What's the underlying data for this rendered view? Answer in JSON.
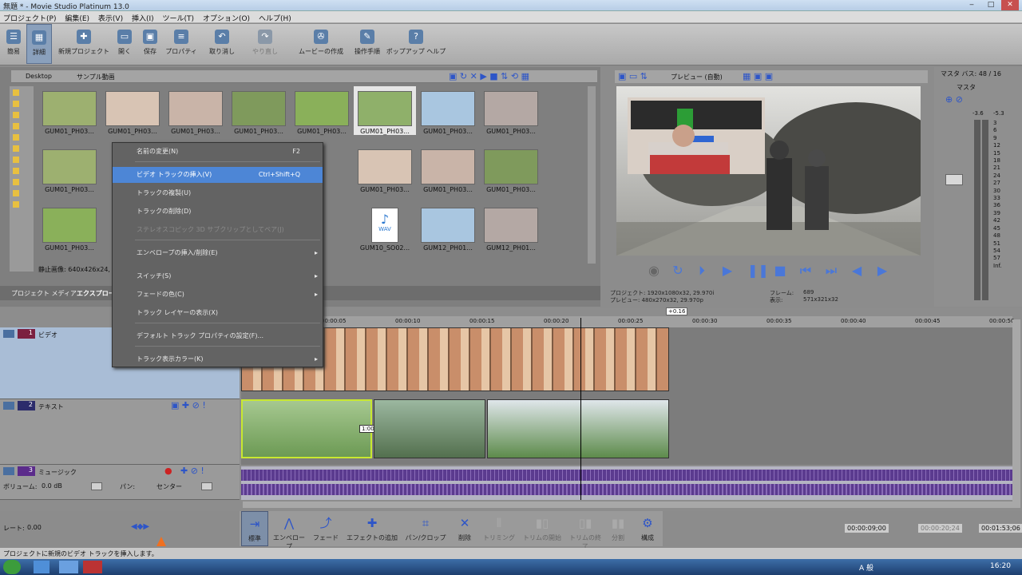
{
  "window": {
    "title": "無題 * - Movie Studio Platinum 13.0",
    "controls": [
      "‒",
      "□",
      "✕"
    ]
  },
  "menu": [
    "プロジェクト(P)",
    "編集(E)",
    "表示(V)",
    "挿入(I)",
    "ツール(T)",
    "オプション(O)",
    "ヘルプ(H)"
  ],
  "toolbar": [
    {
      "label": "簡易",
      "icon": "simple-view-icon",
      "disabled": false
    },
    {
      "label": "詳細",
      "icon": "detail-view-icon",
      "disabled": false
    },
    {
      "label": "新規プロジェクト",
      "icon": "new-project-icon",
      "disabled": false
    },
    {
      "label": "開く",
      "icon": "open-folder-icon",
      "disabled": false
    },
    {
      "label": "保存",
      "icon": "save-icon",
      "disabled": false
    },
    {
      "label": "プロパティ",
      "icon": "properties-icon",
      "disabled": false
    },
    {
      "label": "取り消し",
      "icon": "undo-icon",
      "disabled": false
    },
    {
      "label": "やり直し",
      "icon": "redo-icon",
      "disabled": true
    },
    {
      "label": "ムービーの作成",
      "icon": "make-movie-icon",
      "disabled": false
    },
    {
      "label": "操作手順",
      "icon": "wizard-icon",
      "disabled": false
    },
    {
      "label": "ポップアップ ヘルプ",
      "icon": "popup-help-icon",
      "disabled": false
    }
  ],
  "explorer": {
    "path": [
      "Desktop",
      "サンプル動画"
    ],
    "status": "静止画像: 640x426x24,",
    "thumbs": [
      "GUM01_PH03...",
      "GUM01_PH03...",
      "GUM01_PH03...",
      "GUM01_PH03...",
      "GUM01_PH03...",
      "GUM01_PH03...",
      "GUM01_PH03...",
      "GUM01_PH03...",
      "GUM01_PH03...",
      "GUM01_PH03...",
      "GUM01_PH03...",
      "GUM01_PH03...",
      "GUM01_PH03...",
      "GUM01_PH03...",
      "GUM01_PH03...",
      "GUM01_PH03...",
      "GUM01_PH03...",
      "GUM01_PH03...",
      "GUM01_PH03...",
      "GUM01_PH03...",
      "GUM01_PH03...",
      "GUM01_PH03...",
      "GUM10_SO02...",
      "GUM10_SO02...",
      "GUM12_PH01...",
      "GUM12_PH01..."
    ],
    "tabs": [
      "プロジェクト メディア",
      "エクスプロー"
    ],
    "wav_label": "WAV"
  },
  "context_menu": [
    {
      "label": "名前の変更(N)",
      "shortcut": "F2",
      "submenu": false,
      "selected": false,
      "disabled": false
    },
    {
      "label": "ビデオ トラックの挿入(V)",
      "shortcut": "Ctrl+Shift+Q",
      "submenu": false,
      "selected": true,
      "disabled": false
    },
    {
      "label": "トラックの複製(U)",
      "shortcut": "",
      "submenu": false,
      "selected": false,
      "disabled": false
    },
    {
      "label": "トラックの削除(D)",
      "shortcut": "",
      "submenu": false,
      "selected": false,
      "disabled": false
    },
    {
      "label": "ステレオスコピック 3D サブクリップとしてペア(J)",
      "shortcut": "",
      "submenu": false,
      "selected": false,
      "disabled": true
    },
    {
      "label": "エンベロープの挿入/削除(E)",
      "shortcut": "",
      "submenu": true,
      "selected": false,
      "disabled": false
    },
    {
      "label": "スイッチ(S)",
      "shortcut": "",
      "submenu": true,
      "selected": false,
      "disabled": false
    },
    {
      "label": "フェードの色(C)",
      "shortcut": "",
      "submenu": true,
      "selected": false,
      "disabled": false
    },
    {
      "label": "トラック レイヤーの表示(X)",
      "shortcut": "",
      "submenu": false,
      "selected": false,
      "disabled": false
    },
    {
      "label": "デフォルト トラック プロパティの設定(F)...",
      "shortcut": "",
      "submenu": false,
      "selected": false,
      "disabled": false
    },
    {
      "label": "トラック表示カラー(K)",
      "shortcut": "",
      "submenu": true,
      "selected": false,
      "disabled": false
    }
  ],
  "preview": {
    "mode": "プレビュー (自動)",
    "project": "プロジェクト: 1920x1080x32, 29.970i",
    "preview": "プレビュー: 480x270x32, 29.970p",
    "frame_label": "フレーム:",
    "frame": "689",
    "display_label": "表示:",
    "display": "571x321x32"
  },
  "master": {
    "title": "マスタ バス: 48 / 16",
    "label": "マスタ",
    "left_db": "-3.6",
    "right_db": "-5.3",
    "scale": [
      "3",
      "6",
      "9",
      "12",
      "15",
      "18",
      "21",
      "24",
      "27",
      "30",
      "33",
      "36",
      "39",
      "42",
      "45",
      "48",
      "51",
      "54",
      "57",
      "Inf."
    ]
  },
  "timeline": {
    "cursor_time": "+0.16",
    "ruler": [
      "00:00:05",
      "00:00:10",
      "00:00:15",
      "00:00:20",
      "00:00:25",
      "00:00:30",
      "00:00:35",
      "00:00:40",
      "00:00:45",
      "00:00:50"
    ],
    "tracks": [
      {
        "num": "1",
        "name": "ビデオ"
      },
      {
        "num": "2",
        "name": "テキスト",
        "event_time": "1:00"
      },
      {
        "num": "3",
        "name": "ミュージック",
        "volume_label": "ボリューム:",
        "volume": "0.0 dB",
        "pan_label": "パン:",
        "pan": "センター"
      }
    ],
    "rate_label": "レート:",
    "rate": "0.00"
  },
  "edit_tools": [
    {
      "label": "標準",
      "icon": "normal-edit-icon",
      "disabled": false
    },
    {
      "label": "エンベロープ",
      "icon": "envelope-icon",
      "disabled": false
    },
    {
      "label": "フェード",
      "icon": "fade-icon",
      "disabled": false
    },
    {
      "label": "エフェクトの追加",
      "icon": "add-effect-icon",
      "disabled": false
    },
    {
      "label": "パン/クロップ",
      "icon": "pan-crop-icon",
      "disabled": false
    },
    {
      "label": "削除",
      "icon": "delete-icon",
      "disabled": false
    },
    {
      "label": "トリミング",
      "icon": "trim-icon",
      "disabled": true
    },
    {
      "label": "トリムの開始",
      "icon": "trim-start-icon",
      "disabled": true
    },
    {
      "label": "トリムの終了",
      "icon": "trim-end-icon",
      "disabled": true
    },
    {
      "label": "分割",
      "icon": "split-icon",
      "disabled": true
    },
    {
      "label": "構成",
      "icon": "settings-icon",
      "disabled": false
    }
  ],
  "times": {
    "current": "00:00:09;00",
    "selection": "00:00:20;24",
    "end": "00:01:53;06"
  },
  "status": "プロジェクトに新規のビデオ トラックを挿入します。",
  "taskbar": {
    "ime": "A 般",
    "clock": "16:20"
  },
  "colors": {
    "accent": "#4d86d6",
    "selection_clip": "#c8e830",
    "audio_wave": "#5b3b8f",
    "ctx_bg": "#636363"
  }
}
